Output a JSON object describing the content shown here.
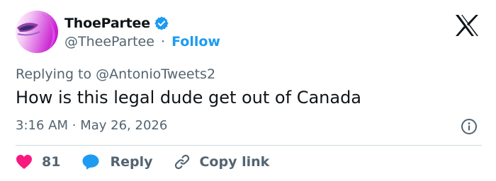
{
  "author": {
    "display_name": "ThoePartee",
    "handle": "@TheePartee",
    "separator": "·",
    "follow_label": "Follow"
  },
  "reply_context": {
    "prefix": "Replying to",
    "mention": "@AntonioTweets2"
  },
  "tweet": {
    "text": "How is this legal dude get out of Canada",
    "time": "3:16 AM",
    "separator": "·",
    "date": "May 26, 2026"
  },
  "actions": {
    "like_count": "81",
    "reply_label": "Reply",
    "copy_label": "Copy link"
  },
  "colors": {
    "like": "#f91880",
    "reply": "#1d9bf0",
    "verified": "#1d9bf0",
    "link": "#1d9bf0",
    "muted": "#536471"
  },
  "icons": [
    "avatar-image",
    "verified-badge-icon",
    "x-logo-icon",
    "info-icon",
    "heart-icon",
    "reply-bubble-icon",
    "link-icon"
  ]
}
